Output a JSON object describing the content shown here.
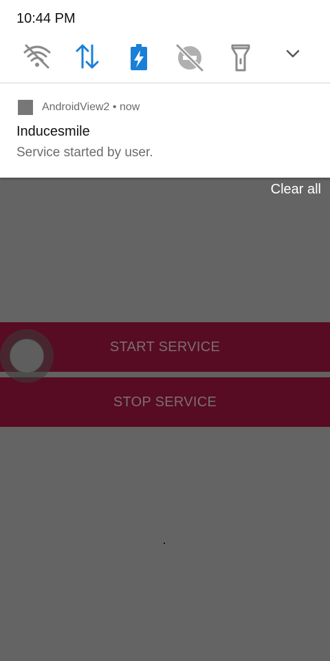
{
  "status_bar": {
    "time": "10:44 PM"
  },
  "quick_settings": {
    "tiles": [
      {
        "icon": "wifi-off-icon",
        "state": "off"
      },
      {
        "icon": "mobile-data-icon",
        "state": "on",
        "color": "#1a7fd6"
      },
      {
        "icon": "battery-saver-icon",
        "state": "on",
        "color": "#1a7fd6"
      },
      {
        "icon": "do-not-disturb-icon",
        "state": "off"
      },
      {
        "icon": "flashlight-icon",
        "state": "off"
      },
      {
        "icon": "expand-chevron-icon"
      }
    ]
  },
  "notification": {
    "app_name": "AndroidView2",
    "separator": "•",
    "time": "now",
    "title": "Inducesmile",
    "text": "Service started by user."
  },
  "shade": {
    "clear_all_label": "Clear all"
  },
  "app": {
    "start_label": "START SERVICE",
    "stop_label": "STOP SERVICE",
    "button_color": "#570c23"
  }
}
